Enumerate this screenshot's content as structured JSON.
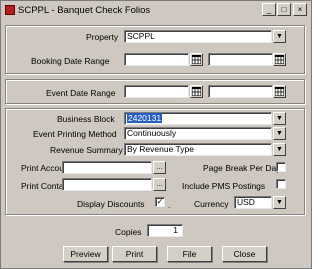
{
  "window": {
    "title": "SCPPL - Banquet Check Folios",
    "controls": {
      "minimize": "_",
      "maximize": "□",
      "close": "×"
    }
  },
  "property": {
    "label": "Property",
    "value": "SCPPL"
  },
  "booking_date": {
    "label": "Booking Date Range",
    "from": "",
    "to": ""
  },
  "event_date": {
    "label": "Event Date Range",
    "from": "",
    "to": ""
  },
  "business_block": {
    "label": "Business Block",
    "value": "2420131"
  },
  "event_printing": {
    "label": "Event Printing Method",
    "value": "Continuously"
  },
  "revenue_summary": {
    "label": "Revenue Summary",
    "value": "By Revenue Type"
  },
  "print_account": {
    "label": "Print Account",
    "value": ""
  },
  "print_contact": {
    "label": "Print Contact",
    "value": ""
  },
  "page_break": {
    "label": "Page Break Per Day",
    "checked": false
  },
  "include_pms": {
    "label": "Include PMS Postings",
    "checked": false
  },
  "display_discounts": {
    "label": "Display Discounts",
    "checked": true,
    "mark": "✓"
  },
  "currency": {
    "label": "Currency",
    "value": "USD"
  },
  "copies": {
    "label": "Copies",
    "value": "1"
  },
  "buttons": {
    "preview": "Preview",
    "print": "Print",
    "file": "File",
    "close": "Close"
  },
  "icons": {
    "dropdown": "dropdown-arrow-icon",
    "calendar": "calendar-icon",
    "lov": "ellipsis-icon"
  }
}
